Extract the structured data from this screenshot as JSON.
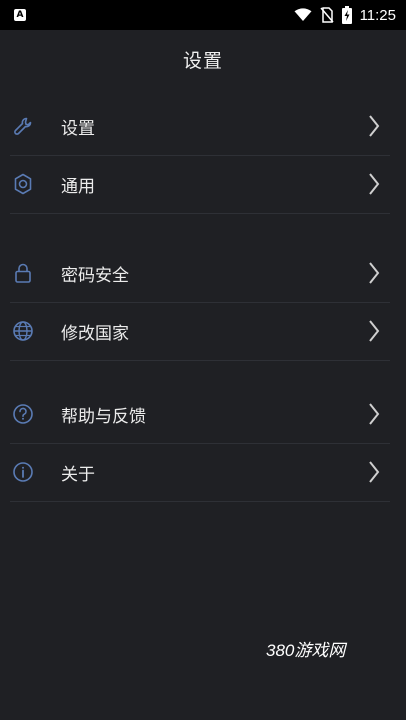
{
  "status_bar": {
    "time": "11:25",
    "notification_letter": "A"
  },
  "header": {
    "title": "设置"
  },
  "groups": [
    {
      "items": [
        {
          "label": "设置",
          "icon": "wrench-icon"
        },
        {
          "label": "通用",
          "icon": "gear-icon"
        }
      ]
    },
    {
      "items": [
        {
          "label": "密码安全",
          "icon": "lock-icon"
        },
        {
          "label": "修改国家",
          "icon": "globe-icon"
        }
      ]
    },
    {
      "items": [
        {
          "label": "帮助与反馈",
          "icon": "help-circle-icon"
        },
        {
          "label": "关于",
          "icon": "info-circle-icon"
        }
      ]
    }
  ],
  "watermark": "380游戏网",
  "colors": {
    "background": "#1f2024",
    "icon": "#5a7bb4",
    "divider": "#2e3036"
  }
}
